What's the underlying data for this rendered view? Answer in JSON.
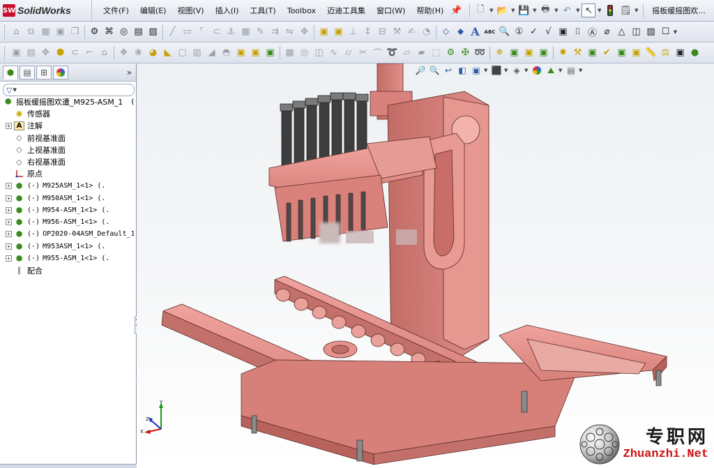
{
  "app": {
    "logo_mark": "SW",
    "name": "SolidWorks",
    "document_title": "摇板缓摇图欢...",
    "accent_color": "#c8102e"
  },
  "menu": {
    "items": [
      {
        "label": "文件(F)"
      },
      {
        "label": "编辑(E)"
      },
      {
        "label": "视图(V)"
      },
      {
        "label": "插入(I)"
      },
      {
        "label": "工具(T)"
      },
      {
        "label": "Toolbox"
      },
      {
        "label": "迈迪工具集"
      },
      {
        "label": "窗口(W)"
      },
      {
        "label": "帮助(H)"
      }
    ],
    "pin_icon": "pin-icon"
  },
  "quick_access": {
    "icons": [
      "new-document-icon",
      "open-folder-icon",
      "save-icon",
      "print-icon",
      "undo-icon",
      "select-arrow-icon",
      "rebuild-traffic-light-icon",
      "options-icon"
    ]
  },
  "toolbar2_text": {
    "text_icon_label": "A",
    "spell_icon_label": "ABC"
  },
  "feature_tree": {
    "tabs": [
      "feature-manager-tab",
      "property-manager-tab",
      "configuration-manager-tab",
      "display-manager-tab"
    ],
    "expand_glyph": "»",
    "root": {
      "label": "摇板缓摇图欢遭_M925-ASM_1",
      "suffix": "("
    },
    "items": [
      {
        "label": "传感器",
        "icon": "sensor-folder-icon",
        "expandable": false
      },
      {
        "label": "注解",
        "icon": "annotation-icon",
        "expandable": true
      },
      {
        "label": "前视基准面",
        "icon": "plane-icon",
        "expandable": false
      },
      {
        "label": "上视基准面",
        "icon": "plane-icon",
        "expandable": false
      },
      {
        "label": "右视基准面",
        "icon": "plane-icon",
        "expandable": false
      },
      {
        "label": "原点",
        "icon": "origin-icon",
        "expandable": false
      }
    ],
    "components": [
      {
        "state": "(-)",
        "label": "M925ASM_1<1> (."
      },
      {
        "state": "(-)",
        "label": "M950ASM_1<1> (."
      },
      {
        "state": "(-)",
        "label": "M954-ASM_1<1> (."
      },
      {
        "state": "(-)",
        "label": "M956-ASM_1<1> (."
      },
      {
        "state": "(-)",
        "label": "OP2020-04ASM_Default_1"
      },
      {
        "state": "(-)",
        "label": "M953ASM_1<1> (."
      },
      {
        "state": "(-)",
        "label": "M955-ASM_1<1> (."
      }
    ],
    "mates": {
      "label": "配合",
      "icon": "mates-icon"
    }
  },
  "heads_up_toolbar": {
    "icons": [
      "zoom-to-fit-icon",
      "zoom-area-icon",
      "previous-view-icon",
      "section-view-icon",
      "view-orientation-icon",
      "display-style-icon",
      "hide-show-icon",
      "edit-appearance-icon",
      "apply-scene-icon",
      "view-settings-icon"
    ]
  },
  "triad": {
    "x_label": "X",
    "y_label": "Y",
    "z_label": "Z"
  },
  "watermark": {
    "chinese": "专职网",
    "english": "Zhuanzhi.Net"
  },
  "colors": {
    "model": "#d9827c",
    "model_dark": "#a8504b",
    "model_line": "#5a2a27",
    "viewport_top": "#eef1f4"
  }
}
